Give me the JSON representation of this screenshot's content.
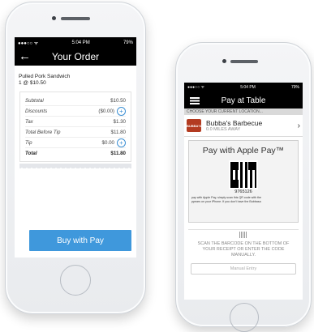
{
  "left_phone": {
    "status": {
      "time": "5:04 PM",
      "battery": "79%",
      "signal": "●●●○○ ᯤ"
    },
    "nav": {
      "title": "Your Order",
      "back_glyph": "←"
    },
    "item": {
      "name": "Pulled Pork Sandwich",
      "qty_price": "1 @ $10.50"
    },
    "rows": [
      {
        "label": "Subtotal",
        "value": "$10.50"
      },
      {
        "label": "Discounts",
        "value": "($0.00)"
      },
      {
        "label": "Tax",
        "value": "$1.30"
      },
      {
        "label": "Total Before Tip",
        "value": "$11.80"
      },
      {
        "label": "Tip",
        "value": "$0.00"
      },
      {
        "label": "Total",
        "value": "$11.80"
      }
    ],
    "pay_button": "Buy with  Pay"
  },
  "right_phone": {
    "status": {
      "time": "5:04 PM",
      "battery": "79%",
      "signal": "●●●○○ ᯤ"
    },
    "nav": {
      "title": "Pay at Table"
    },
    "choose_location": "CHOOSE YOUR CURRENT LOCATION...",
    "restaurant": {
      "name": "Bubba's Barbecue",
      "distance": "0.0 MILES AWAY",
      "logo_text": "BUBBA'S"
    },
    "apple_pay": {
      "title": "Pay with Apple Pay™",
      "code": "9765126",
      "instructions_line1": "pay with Apple Pay, simply scan this QR code with the",
      "instructions_line2": "ppears on your iPhone. If you don't have the Bubbasa"
    },
    "scan_text": "SCAN THE BARCODE ON THE BOTTOM OF YOUR RECEIPT OR ENTER THE CODE MANUALLY.",
    "manual_entry": "Manual Entry"
  },
  "icons": {
    "plus": "+",
    "chevron": "›"
  },
  "colors": {
    "accent_blue": "#3f98dc",
    "nav_black": "#000000",
    "logo_red": "#b33b21"
  }
}
